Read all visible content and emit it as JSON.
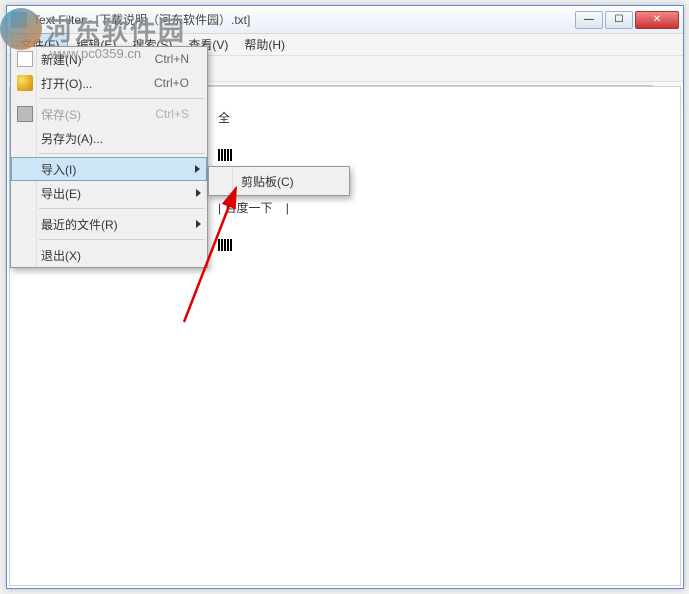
{
  "watermark": {
    "text": "河东软件园",
    "url": "www.pc0359.cn"
  },
  "window": {
    "title": "Text Filter - [下载说明（河东软件园）.txt]",
    "buttons": {
      "min": "—",
      "max": "☐",
      "close": "✕"
    }
  },
  "menubar": {
    "items": [
      "文件(F)",
      "编辑(E)",
      "搜索(S)",
      "查看(V)",
      "帮助(H)"
    ]
  },
  "search": {
    "placeholder": "",
    "close": "×"
  },
  "content": {
    "line1": "全",
    "line2a": "| 百度一下    |"
  },
  "dropdown": {
    "items": [
      {
        "label": "新建(N)",
        "shortcut": "Ctrl+N",
        "icon": "new",
        "disabled": false
      },
      {
        "label": "打开(O)...",
        "shortcut": "Ctrl+O",
        "icon": "open",
        "disabled": false
      },
      {
        "sep": true
      },
      {
        "label": "保存(S)",
        "shortcut": "Ctrl+S",
        "icon": "save",
        "disabled": true
      },
      {
        "label": "另存为(A)...",
        "shortcut": "",
        "disabled": false
      },
      {
        "sep": true
      },
      {
        "label": "导入(I)",
        "shortcut": "",
        "submenu": true,
        "highlighted": true
      },
      {
        "label": "导出(E)",
        "shortcut": "",
        "submenu": true
      },
      {
        "sep": true
      },
      {
        "label": "最近的文件(R)",
        "shortcut": "",
        "submenu": true
      },
      {
        "sep": true
      },
      {
        "label": "退出(X)",
        "shortcut": ""
      }
    ]
  },
  "submenu": {
    "items": [
      {
        "label": "剪贴板(C)"
      }
    ]
  }
}
